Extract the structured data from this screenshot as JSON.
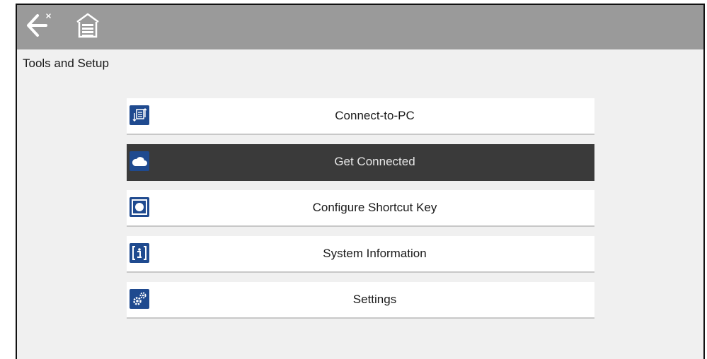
{
  "topbar": {
    "back_icon": "back-arrow-icon",
    "home_icon": "home-icon"
  },
  "page": {
    "title": "Tools and Setup"
  },
  "menu": {
    "items": [
      {
        "label": "Connect-to-PC",
        "icon": "connect-to-pc-icon",
        "selected": false
      },
      {
        "label": "Get Connected",
        "icon": "cloud-icon",
        "selected": true
      },
      {
        "label": "Configure Shortcut Key",
        "icon": "shortcut-key-icon",
        "selected": false
      },
      {
        "label": "System Information",
        "icon": "info-icon",
        "selected": false
      },
      {
        "label": "Settings",
        "icon": "gears-icon",
        "selected": false
      }
    ]
  },
  "colors": {
    "topbar": "#9a9a9a",
    "background": "#f0f0f0",
    "icon_blue": "#1f4a8f",
    "selected_row": "#3a3a3a"
  }
}
